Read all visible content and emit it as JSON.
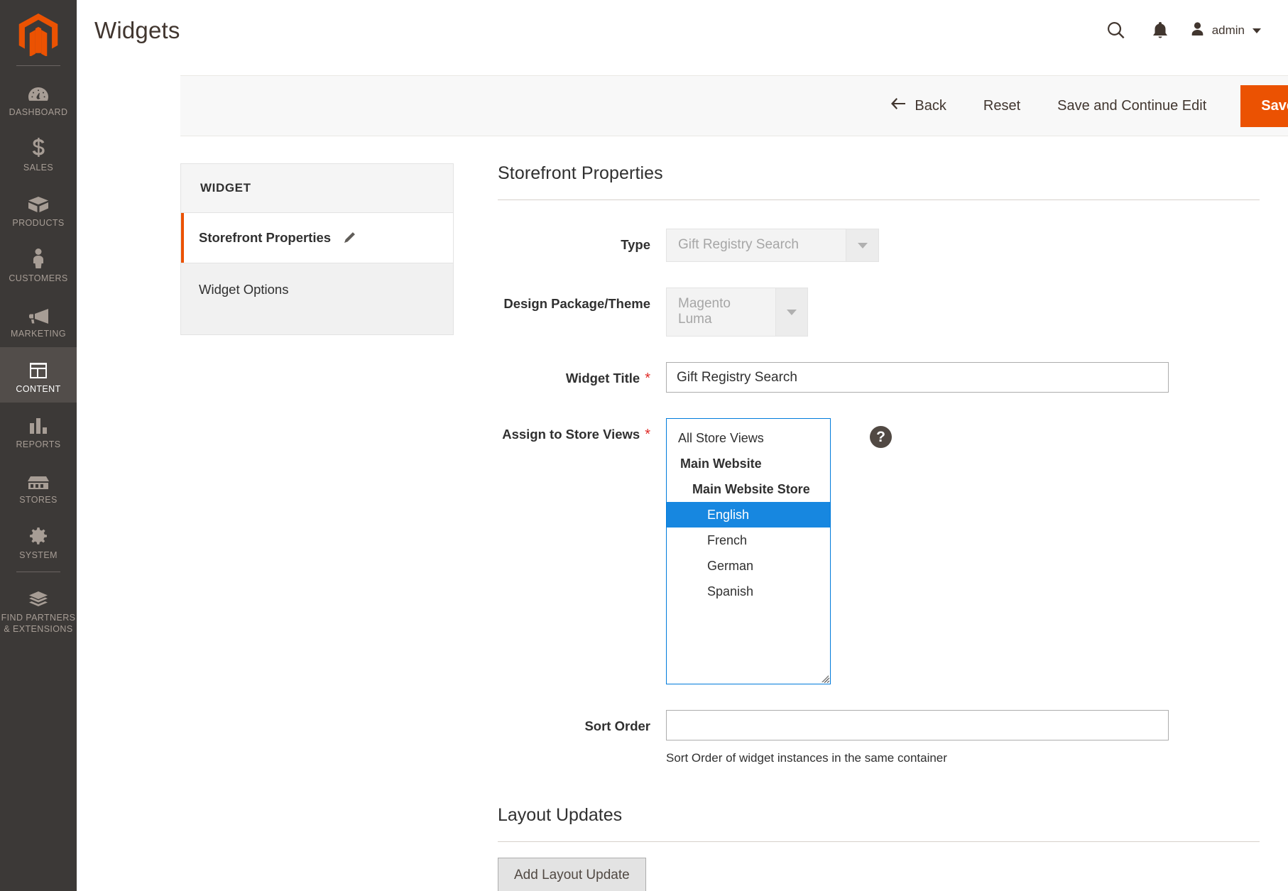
{
  "sidebar": {
    "logo_name": "magento-logo",
    "items": [
      {
        "label": "Dashboard",
        "icon": "dashboard-icon",
        "active": false
      },
      {
        "label": "Sales",
        "icon": "dollar-icon",
        "active": false
      },
      {
        "label": "Products",
        "icon": "box-icon",
        "active": false
      },
      {
        "label": "Customers",
        "icon": "person-icon",
        "active": false
      },
      {
        "label": "Marketing",
        "icon": "megaphone-icon",
        "active": false
      },
      {
        "label": "Content",
        "icon": "layout-icon",
        "active": true
      },
      {
        "label": "Reports",
        "icon": "bar-chart-icon",
        "active": false
      },
      {
        "label": "Stores",
        "icon": "storefront-icon",
        "active": false
      },
      {
        "label": "System",
        "icon": "gear-icon",
        "active": false
      },
      {
        "label": "Find Partners & Extensions",
        "icon": "extensions-icon",
        "active": false
      }
    ]
  },
  "header": {
    "title": "Widgets",
    "search_icon": "search-icon",
    "notifications_icon": "bell-icon",
    "avatar_icon": "user-avatar-icon",
    "admin_label": "admin",
    "caret_icon": "chevron-down-icon"
  },
  "toolbar": {
    "back_label": "Back",
    "back_icon": "arrow-left-icon",
    "reset_label": "Reset",
    "save_continue_label": "Save and Continue Edit",
    "save_label": "Save",
    "save_color": "#eb5202"
  },
  "widget_tabs": {
    "heading": "WIDGET",
    "items": [
      {
        "label": "Storefront Properties",
        "icon": "pencil-icon",
        "active": true
      },
      {
        "label": "Widget Options",
        "icon": "",
        "active": false
      }
    ]
  },
  "form": {
    "section_title": "Storefront Properties",
    "type": {
      "label": "Type",
      "value": "Gift Registry Search",
      "disabled": true
    },
    "design_theme": {
      "label": "Design Package/Theme",
      "value": "Magento Luma",
      "disabled": true
    },
    "widget_title": {
      "label": "Widget Title",
      "required_marker": "*",
      "value": "Gift Registry Search",
      "placeholder": ""
    },
    "assign_store_views": {
      "label": "Assign to Store Views",
      "required_marker": "*",
      "help_icon": "question-mark-icon",
      "options": [
        {
          "text": "All Store Views",
          "level": 0,
          "selected": false
        },
        {
          "text": "Main Website",
          "level": 1,
          "selected": false
        },
        {
          "text": "Main Website Store",
          "level": 2,
          "selected": false
        },
        {
          "text": "English",
          "level": 3,
          "selected": true
        },
        {
          "text": "French",
          "level": 3,
          "selected": false
        },
        {
          "text": "German",
          "level": 3,
          "selected": false
        },
        {
          "text": "Spanish",
          "level": 3,
          "selected": false
        }
      ],
      "selected_color": "#1787e0"
    },
    "sort_order": {
      "label": "Sort Order",
      "value": "",
      "placeholder": "",
      "hint": "Sort Order of widget instances in the same container"
    }
  },
  "layout_updates": {
    "section_title": "Layout Updates",
    "add_button_label": "Add Layout Update"
  }
}
